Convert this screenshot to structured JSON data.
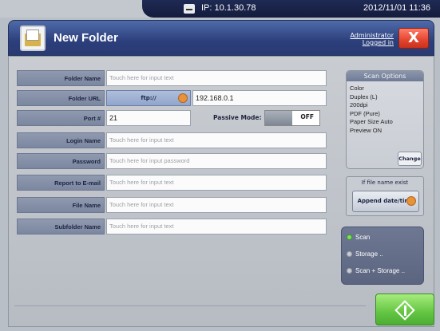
{
  "status": {
    "ip": "IP: 10.1.30.78",
    "datetime": "2012/11/01 11:36"
  },
  "header": {
    "title": "New Folder",
    "admin_line1": "Administrator",
    "admin_line2": "Logged in",
    "close_label": "X"
  },
  "form": {
    "folder_name": {
      "label": "Folder Name",
      "placeholder": "Touch here for input text"
    },
    "folder_url": {
      "label": "Folder URL",
      "protocol": "ftp://",
      "value": "192.168.0.1"
    },
    "port": {
      "label": "Port #",
      "value": "21"
    },
    "passive_mode": {
      "label": "Passive Mode:",
      "state": "OFF"
    },
    "login_name": {
      "label": "Login Name",
      "placeholder": "Touch here for input text"
    },
    "password": {
      "label": "Password",
      "placeholder": "Touch here for input password"
    },
    "report_email": {
      "label": "Report to E-mail",
      "placeholder": "Touch here for input text"
    },
    "file_name": {
      "label": "File Name",
      "placeholder": "Touch here for input text"
    },
    "subfolder_name": {
      "label": "Subfolder Name",
      "placeholder": "Touch here for input text"
    }
  },
  "scan_options": {
    "title": "Scan Options",
    "items": [
      "Color",
      "Duplex (L)",
      "200dpi",
      "PDF (Pure)",
      "Paper Size Auto",
      "Preview ON"
    ],
    "change_label": "Change"
  },
  "file_exists": {
    "caption": "If file name exist",
    "button_label": "Append date/time"
  },
  "modes": {
    "items": [
      "Scan",
      "Storage ..",
      "Scan + Storage .."
    ],
    "selected": "Scan"
  },
  "colors": {
    "header": "#2c3f7c",
    "close": "#e3452e",
    "start": "#63c542",
    "label_bg": "#7b86a0"
  },
  "icons": {
    "folder": "folder-icon",
    "printer": "printer-icon",
    "start": "start-icon"
  }
}
